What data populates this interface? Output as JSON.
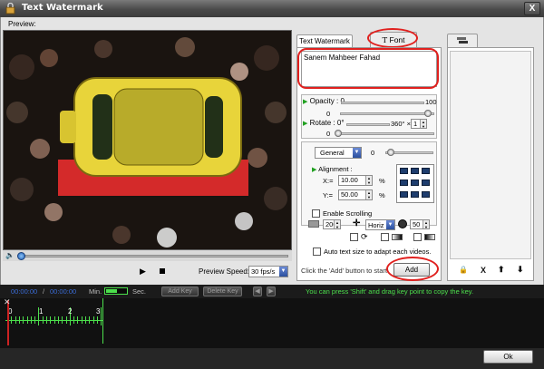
{
  "window": {
    "title": "Text Watermark",
    "close_label": "X"
  },
  "preview": {
    "label": "Preview:",
    "speed_label": "Preview Speed:",
    "speed_value": "30 fps/s"
  },
  "tabs": {
    "text_watermark": "Text Watermark",
    "font": "Font",
    "font_glyph": "T"
  },
  "editor": {
    "text_value": "Sanem Mahbeer Fahad",
    "opacity_label": "Opacity :",
    "opacity_min": "0",
    "opacity_max": "100",
    "opacity_value": "0",
    "rotate_label": "Rotate :",
    "rotate_min": "0°",
    "rotate_max": "360°",
    "rotate_mult_sign": "×",
    "rotate_mult": "1",
    "rotate_value": "0",
    "general_select": "General",
    "general_value": "0",
    "alignment_label": "Alignment :",
    "x_label": "X:=",
    "x_value": "10.00",
    "y_label": "Y:=",
    "y_value": "50.00",
    "percent": "%",
    "enable_scrolling": "Enable Scrolling",
    "scroll_speed": "200",
    "scroll_dir": "Horiz",
    "scroll_time": "50",
    "auto_text_size": "Auto text size to adapt each videos.",
    "hint": "Click the 'Add' button to start.",
    "add_label": "Add"
  },
  "list_tools": {
    "lock": "🔒",
    "delete": "X",
    "up": "⬆",
    "down": "⬇"
  },
  "timeline": {
    "time_start": "00:00:00",
    "time_sep": "/",
    "time_end": "00:00:00",
    "min_label": "Min.",
    "sec_label": "Sec.",
    "add_key": "Add Key",
    "delete_key": "Delete Key",
    "prev_key": "◀",
    "next_key": "▶",
    "shift_hint": "You can press 'Shift' and drag key point to copy the key.",
    "ruler": [
      "0",
      "1",
      "2",
      "3"
    ],
    "zoom_level": 0.5
  },
  "footer": {
    "ok_label": "Ok"
  },
  "colors": {
    "accent_red": "#e0201e",
    "timeline_green": "#4ce04c",
    "time_blue": "#3a6cd6",
    "car_yellow": "#e8d43a"
  }
}
